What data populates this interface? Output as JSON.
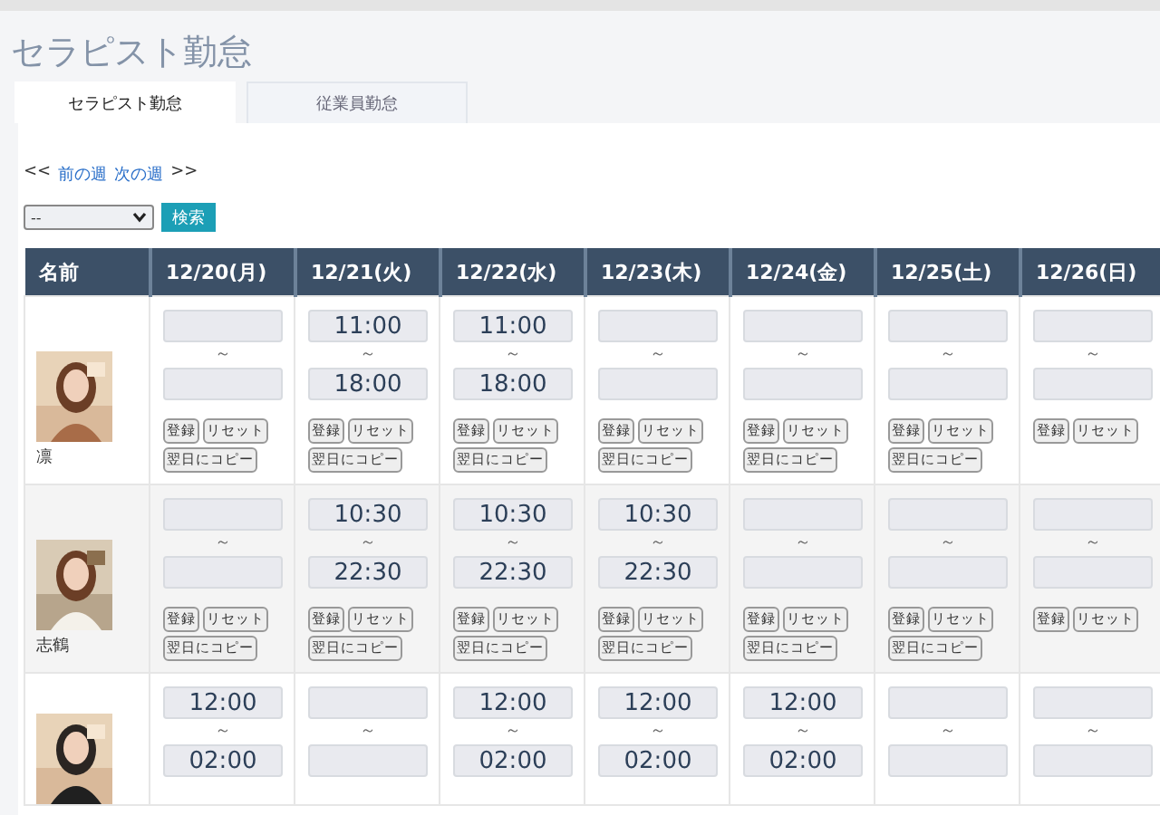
{
  "title": "セラピスト勤怠",
  "tabs": [
    {
      "label": "セラピスト勤怠",
      "selected": true
    },
    {
      "label": "従業員勤怠",
      "selected": false
    }
  ],
  "week_nav": {
    "prefix": "<<",
    "prev": "前の週",
    "next": "次の週",
    "suffix": ">>"
  },
  "filter": {
    "select_value": "--",
    "button": "検索"
  },
  "table": {
    "columns": [
      "名前",
      "12/20(月)",
      "12/21(火)",
      "12/22(水)",
      "12/23(木)",
      "12/24(金)",
      "12/25(土)",
      "12/26(日)"
    ],
    "rows": [
      {
        "cells": [
          {
            "kind": "person",
            "name": "凛"
          },
          {
            "kind": "shift",
            "separator": "～",
            "buttons": [
              "登録",
              "リセット",
              "翌日にコピー"
            ]
          },
          {
            "kind": "shift",
            "start": "11:00",
            "separator": "～",
            "end": "18:00",
            "buttons": [
              "登録",
              "リセット",
              "翌日にコピー"
            ]
          },
          {
            "kind": "shift",
            "start": "11:00",
            "separator": "～",
            "end": "18:00",
            "buttons": [
              "登録",
              "リセット",
              "翌日にコピー"
            ]
          },
          {
            "kind": "shift",
            "separator": "～",
            "buttons": [
              "登録",
              "リセット",
              "翌日にコピー"
            ]
          },
          {
            "kind": "shift",
            "separator": "～",
            "buttons": [
              "登録",
              "リセット",
              "翌日にコピー"
            ]
          },
          {
            "kind": "shift",
            "separator": "～",
            "buttons": [
              "登録",
              "リセット",
              "翌日にコピー"
            ]
          },
          {
            "kind": "shift",
            "separator": "～",
            "buttons": [
              "登録",
              "リセット"
            ]
          }
        ]
      },
      {
        "cells": [
          {
            "kind": "person",
            "name": "志鶴"
          },
          {
            "kind": "shift",
            "separator": "～",
            "buttons": [
              "登録",
              "リセット",
              "翌日にコピー"
            ]
          },
          {
            "kind": "shift",
            "start": "10:30",
            "separator": "～",
            "end": "22:30",
            "buttons": [
              "登録",
              "リセット",
              "翌日にコピー"
            ]
          },
          {
            "kind": "shift",
            "start": "10:30",
            "separator": "～",
            "end": "22:30",
            "buttons": [
              "登録",
              "リセット",
              "翌日にコピー"
            ]
          },
          {
            "kind": "shift",
            "start": "10:30",
            "separator": "～",
            "end": "22:30",
            "buttons": [
              "登録",
              "リセット",
              "翌日にコピー"
            ]
          },
          {
            "kind": "shift",
            "separator": "～",
            "buttons": [
              "登録",
              "リセット",
              "翌日にコピー"
            ]
          },
          {
            "kind": "shift",
            "separator": "～",
            "buttons": [
              "登録",
              "リセット",
              "翌日にコピー"
            ]
          },
          {
            "kind": "shift",
            "separator": "～",
            "buttons": [
              "登録",
              "リセット"
            ]
          }
        ]
      },
      {
        "cells": [
          {
            "kind": "person"
          },
          {
            "kind": "shift",
            "start": "12:00",
            "separator": "～",
            "end": "02:00"
          },
          {
            "kind": "shift",
            "separator": "～"
          },
          {
            "kind": "shift",
            "start": "12:00",
            "separator": "～",
            "end": "02:00"
          },
          {
            "kind": "shift",
            "start": "12:00",
            "separator": "～",
            "end": "02:00"
          },
          {
            "kind": "shift",
            "start": "12:00",
            "separator": "～",
            "end": "02:00"
          },
          {
            "kind": "shift",
            "separator": "～"
          },
          {
            "kind": "shift",
            "separator": "～"
          }
        ]
      }
    ]
  }
}
